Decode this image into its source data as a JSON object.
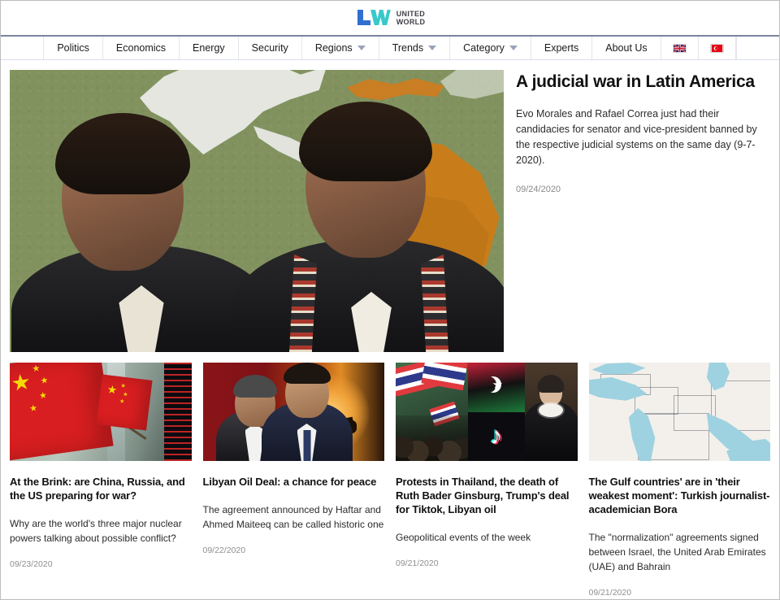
{
  "site": {
    "logo_mark": "LW",
    "logo_line1": "UNITED",
    "logo_line2": "WORLD",
    "logo_blue": "#2f6fd0",
    "logo_teal": "#39c9c9"
  },
  "nav": {
    "items": [
      {
        "label": "Politics",
        "has_dropdown": false
      },
      {
        "label": "Economics",
        "has_dropdown": false
      },
      {
        "label": "Energy",
        "has_dropdown": false
      },
      {
        "label": "Security",
        "has_dropdown": false
      },
      {
        "label": "Regions",
        "has_dropdown": true
      },
      {
        "label": "Trends",
        "has_dropdown": true
      },
      {
        "label": "Category",
        "has_dropdown": true
      },
      {
        "label": "Experts",
        "has_dropdown": false
      },
      {
        "label": "About Us",
        "has_dropdown": false
      }
    ],
    "languages": [
      {
        "name": "english-flag",
        "label": "EN"
      },
      {
        "name": "turkish-flag",
        "label": "TR"
      }
    ]
  },
  "hero": {
    "title": "A judicial war in Latin America",
    "excerpt": "Evo Morales and Rafael Correa just had their candidacies for senator and vice-president banned by the respective judicial systems on the same day (9-7-2020).",
    "date": "09/24/2020",
    "image_alt": "Rafael Correa and Evo Morales in front of a green map of the Americas"
  },
  "cards": [
    {
      "title": "At the Brink: are China, Russia, and the US preparing for war?",
      "excerpt": "Why are the world's three major nuclear powers talking about possible conflict?",
      "date": "09/23/2020",
      "image_alt": "Chinese national flags in a window"
    },
    {
      "title": "Libyan Oil Deal: a chance for peace",
      "excerpt": "The agreement announced by Haftar and Ahmed Maiteeq can be called historic one",
      "date": "09/22/2020",
      "image_alt": "Khalifa Haftar and Ahmed Maiteeq with oil pump at sunset"
    },
    {
      "title": "Protests in Thailand, the death of Ruth Bader Ginsburg, Trump's deal for Tiktok, Libyan oil",
      "excerpt": "Geopolitical events of the week",
      "date": "09/21/2020",
      "image_alt": "Collage of Thai protest, Libyan flag, TikTok logo and Ruth Bader Ginsburg"
    },
    {
      "title": "The Gulf countries' are in 'their weakest moment': Turkish journalist-academician Bora",
      "excerpt": "The \"normalization\" agreements signed between Israel, the United Arab Emirates (UAE) and Bahrain",
      "date": "09/21/2020",
      "image_alt": "Map of the Middle East and Gulf region"
    }
  ]
}
